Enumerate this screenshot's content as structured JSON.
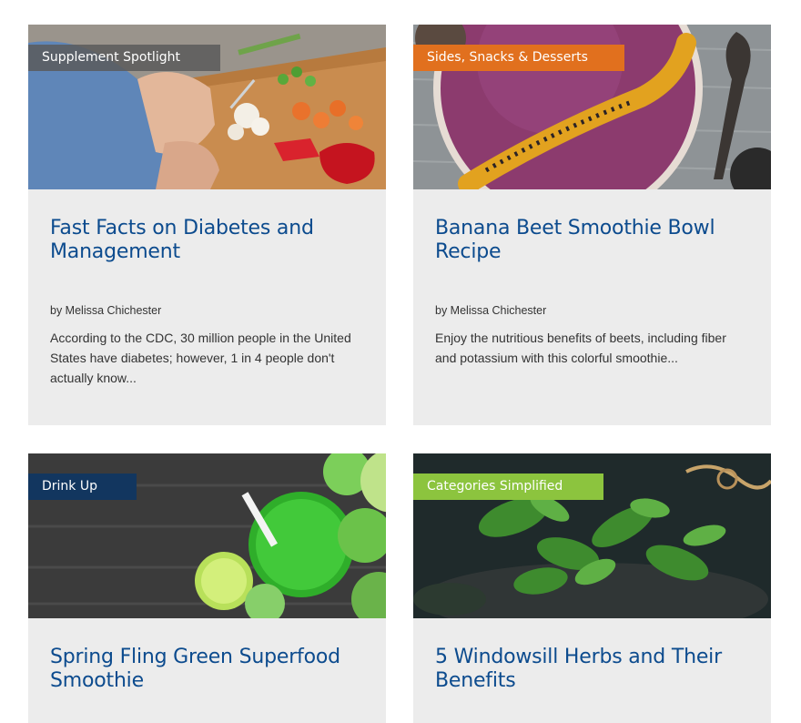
{
  "cards": [
    {
      "tag": "Supplement Spotlight",
      "title": "Fast Facts on Diabetes and Management",
      "byline": "by Melissa Chichester",
      "excerpt": "According to the CDC, 30 million people in the United States have diabetes; however, 1 in 4 people don't actually know..."
    },
    {
      "tag": "Sides, Snacks & Desserts",
      "title": "Banana Beet Smoothie Bowl Recipe",
      "byline": "by Melissa Chichester",
      "excerpt": "Enjoy the nutritious benefits of beets, including fiber and potassium with this colorful smoothie..."
    },
    {
      "tag": "Drink Up",
      "title": "Spring Fling Green Superfood Smoothie"
    },
    {
      "tag": "Categories Simplified",
      "title": "5 Windowsill Herbs and Their Benefits"
    }
  ],
  "colors": {
    "tag_gray": "#5a5a5a",
    "tag_orange": "#e1701e",
    "tag_navy": "#12365f",
    "tag_lime": "#8cc43e",
    "title": "#0c4b8e",
    "card_bg": "#ececec"
  }
}
